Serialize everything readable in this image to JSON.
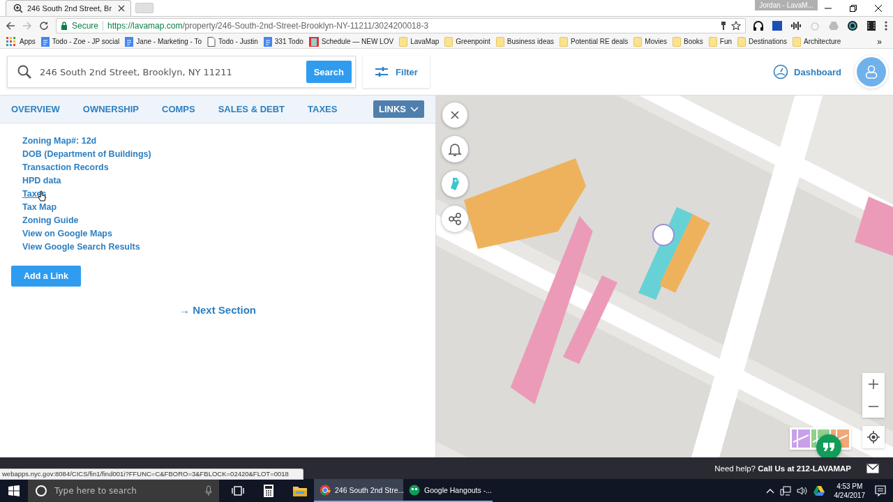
{
  "browser": {
    "tabs": [
      {
        "title": "246 South 2nd Street, Br",
        "selected": true
      }
    ],
    "profile": "Jordan - LavaM...",
    "secure_label": "Secure",
    "url_host": "https://lavamap.com",
    "url_path": "/property/246-South-2nd-Street-Brooklyn-NY-11211/3024200018-3",
    "bookmarks": [
      {
        "label": "Apps",
        "kind": "apps"
      },
      {
        "label": "Todo - Zoe - JP social",
        "kind": "doc"
      },
      {
        "label": "Jane - Marketing - To",
        "kind": "doc"
      },
      {
        "label": "Todo - Justin",
        "kind": "page"
      },
      {
        "label": "331 Todo",
        "kind": "doc"
      },
      {
        "label": "Schedule — NEW LOV",
        "kind": "sheet"
      },
      {
        "label": "LavaMap",
        "kind": "folder"
      },
      {
        "label": "Greenpoint",
        "kind": "folder"
      },
      {
        "label": "Business ideas",
        "kind": "folder"
      },
      {
        "label": "Potential RE deals",
        "kind": "folder"
      },
      {
        "label": "Movies",
        "kind": "folder"
      },
      {
        "label": "Books",
        "kind": "folder"
      },
      {
        "label": "Fun",
        "kind": "folder"
      },
      {
        "label": "Destinations",
        "kind": "folder"
      },
      {
        "label": "Architecture",
        "kind": "folder"
      }
    ],
    "more_bookmarks": "»"
  },
  "app": {
    "search": {
      "value": "246 South 2nd Street, Brooklyn, NY 11211",
      "button": "Search"
    },
    "filter": "Filter",
    "dashboard": "Dashboard",
    "nav": [
      {
        "label": "OVERVIEW",
        "selected": false
      },
      {
        "label": "OWNERSHIP",
        "selected": false
      },
      {
        "label": "COMPS",
        "selected": false
      },
      {
        "label": "SALES & DEBT",
        "selected": false
      },
      {
        "label": "TAXES",
        "selected": false
      },
      {
        "label": "LINKS",
        "selected": true
      }
    ],
    "links": [
      {
        "label": "Zoning Map#: 12d",
        "hovered": false
      },
      {
        "label": "DOB (Department of Buildings)",
        "hovered": false
      },
      {
        "label": "Transaction Records",
        "hovered": false
      },
      {
        "label": "HPD data",
        "hovered": false
      },
      {
        "label": "Taxes",
        "hovered": true
      },
      {
        "label": "Tax Map",
        "hovered": false
      },
      {
        "label": "Zoning Guide",
        "hovered": false
      },
      {
        "label": "View on Google Maps",
        "hovered": false
      },
      {
        "label": "View Google Search Results",
        "hovered": false
      }
    ],
    "add_link": "Add a Link",
    "next_section": "→ Next Section",
    "help": "Need help? **Call Us at 212-LAVAMAP**"
  },
  "status_url": "webapps.nyc.gov:8084/CICS/fin1/find001i?FFUNC=C&FBORO=3&FBLOCK=02420&FLOT=0018",
  "taskbar": {
    "search_placeholder": "Type here to search",
    "apps": [
      {
        "label": "246 South 2nd Stre...",
        "kind": "chrome",
        "selected": true
      },
      {
        "label": "Google Hangouts -...",
        "kind": "hangouts",
        "selected": false
      }
    ],
    "time": "4:53 PM",
    "date": "4/24/2017"
  }
}
